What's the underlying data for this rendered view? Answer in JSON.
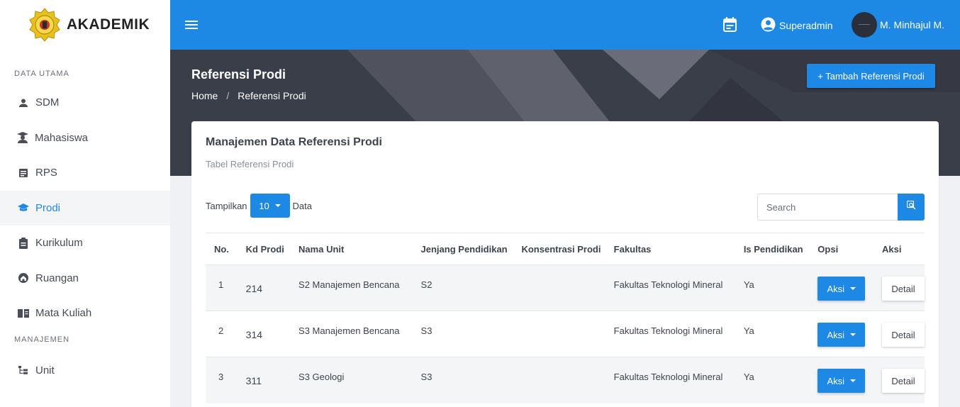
{
  "brand": {
    "name": "AKADEMIK",
    "logo_icon": "university-seal-icon"
  },
  "sidebar": {
    "sections": [
      {
        "label": "DATA UTAMA",
        "items": [
          {
            "label": "SDM",
            "icon": "person-icon"
          },
          {
            "label": "Mahasiswa",
            "icon": "student-icon"
          },
          {
            "label": "RPS",
            "icon": "document-icon"
          },
          {
            "label": "Prodi",
            "icon": "graduation-cap-icon",
            "active": true
          },
          {
            "label": "Kurikulum",
            "icon": "clipboard-icon"
          },
          {
            "label": "Ruangan",
            "icon": "home-icon"
          },
          {
            "label": "Mata Kuliah",
            "icon": "book-icon"
          }
        ]
      },
      {
        "label": "MANAJEMEN",
        "items": [
          {
            "label": "Unit",
            "icon": "hierarchy-icon"
          }
        ]
      }
    ]
  },
  "topbar": {
    "menu_icon": "hamburger-icon",
    "calendar_icon": "calendar-icon",
    "role": "Superadmin",
    "user_name": "M. Minhajul M."
  },
  "page": {
    "title": "Referensi Prodi",
    "breadcrumb": [
      "Home",
      "Referensi Prodi"
    ],
    "add_button": "+ Tambah Referensi Prodi"
  },
  "card": {
    "title": "Manajemen Data Referensi Prodi",
    "subtitle": "Tabel Referensi Prodi",
    "show_prefix": "Tampilkan",
    "show_value": "10",
    "show_suffix": "Data",
    "search_placeholder": "Search"
  },
  "table": {
    "columns": [
      "No.",
      "Kd Prodi",
      "Nama Unit",
      "Jenjang Pendidikan",
      "Konsentrasi Prodi",
      "Fakultas",
      "Is Pendidikan",
      "Opsi",
      "Aksi"
    ],
    "rows": [
      {
        "no": "1",
        "kd": "214",
        "nama": "S2 Manajemen Bencana",
        "jenjang": "S2",
        "konsentrasi": "",
        "fakultas": "Fakultas Teknologi Mineral",
        "is_pendidikan": "Ya",
        "opsi": "Aksi",
        "aksi": "Detail"
      },
      {
        "no": "2",
        "kd": "314",
        "nama": "S3 Manajemen Bencana",
        "jenjang": "S3",
        "konsentrasi": "",
        "fakultas": "Fakultas Teknologi Mineral",
        "is_pendidikan": "Ya",
        "opsi": "Aksi",
        "aksi": "Detail"
      },
      {
        "no": "3",
        "kd": "311",
        "nama": "S3 Geologi",
        "jenjang": "S3",
        "konsentrasi": "",
        "fakultas": "Fakultas Teknologi Mineral",
        "is_pendidikan": "Ya",
        "opsi": "Aksi",
        "aksi": "Detail"
      }
    ]
  },
  "colors": {
    "primary": "#1e88e5",
    "hero_bg": "#3a3e48",
    "active_bg": "#f4f5f7"
  }
}
